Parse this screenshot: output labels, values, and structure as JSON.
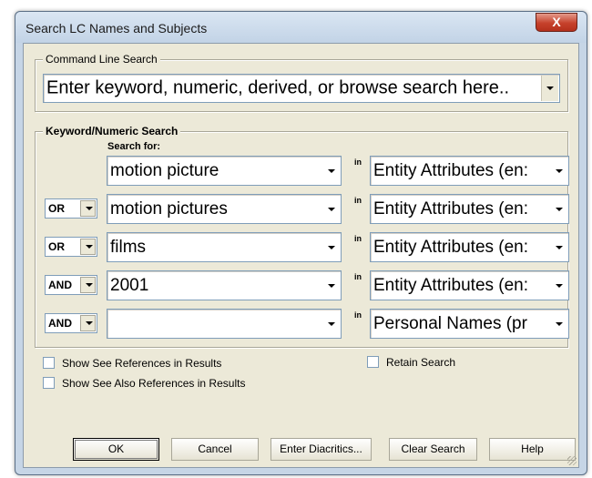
{
  "window": {
    "title": "Search LC Names and Subjects",
    "close_symbol": "X"
  },
  "command_line": {
    "legend": "Command Line Search",
    "placeholder": "Enter keyword, numeric, derived, or browse search here.."
  },
  "keyword": {
    "legend": "Keyword/Numeric Search",
    "search_for_label": "Search for:",
    "in_label": "in",
    "rows": [
      {
        "operator": "",
        "term": "motion picture",
        "field": "Entity Attributes (en:"
      },
      {
        "operator": "OR",
        "term": "motion pictures",
        "field": "Entity Attributes (en:"
      },
      {
        "operator": "OR",
        "term": "films",
        "field": "Entity Attributes (en:"
      },
      {
        "operator": "AND",
        "term": "2001",
        "field": "Entity Attributes (en:"
      },
      {
        "operator": "AND",
        "term": "",
        "field": "Personal Names (pr"
      }
    ]
  },
  "options": {
    "show_see_refs": "Show See References in Results",
    "show_see_also_refs": "Show See Also References in Results",
    "retain_search": "Retain Search"
  },
  "buttons": {
    "ok": "OK",
    "cancel": "Cancel",
    "enter_diacritics": "Enter Diacritics...",
    "clear_search": "Clear Search",
    "help": "Help"
  }
}
